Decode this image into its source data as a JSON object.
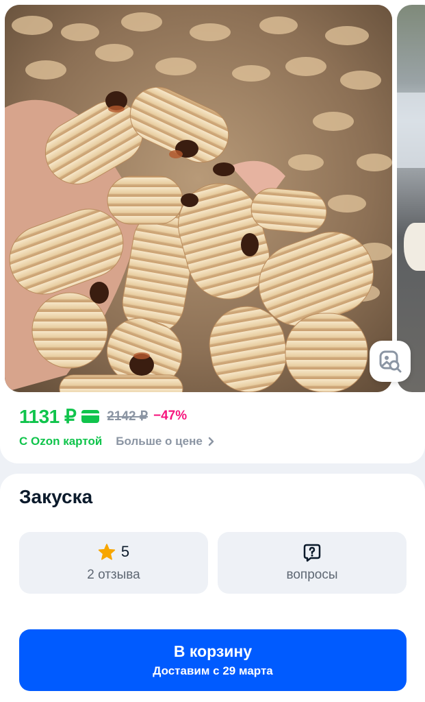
{
  "colors": {
    "price_green": "#10c44c",
    "discount_pink": "#f6157d",
    "muted_gray": "#8b95a3",
    "primary_blue": "#005bff",
    "star_orange": "#f7a600",
    "page_bg": "#eef1f6"
  },
  "gallery": {
    "main_image": "product-photo-grubs",
    "next_image": "product-photo-next",
    "visual_search_icon": "image-search-icon"
  },
  "price": {
    "current": "1131 ₽",
    "card_icon": "ozon-card-icon",
    "old": "2142 ₽",
    "discount": "−47%",
    "ozon_card_label": "С Ozon картой",
    "more_link": "Больше о цене",
    "more_icon": "chevron-right-icon"
  },
  "product": {
    "title": "Закуска"
  },
  "reviews": {
    "icon": "star-icon",
    "rating": "5",
    "count_label": "2 отзыва"
  },
  "questions": {
    "icon": "question-bubble-icon",
    "label": "вопросы"
  },
  "cart": {
    "label": "В корзину",
    "delivery": "Доставим с 29 марта"
  }
}
